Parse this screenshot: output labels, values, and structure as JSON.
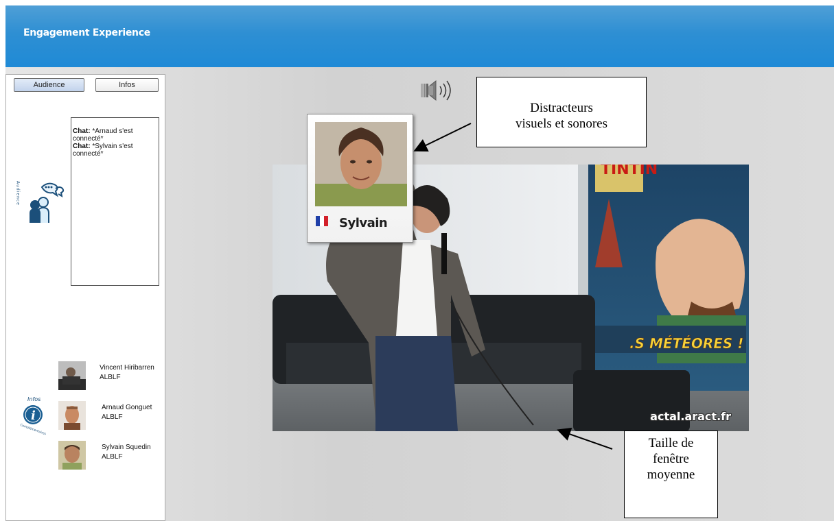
{
  "header": {
    "title": "Engagement Experience"
  },
  "sidebar": {
    "tabs": [
      {
        "label": "Audience"
      },
      {
        "label": "Infos"
      }
    ],
    "audience_label": "Audience",
    "infos_label": "Infos",
    "infos_sub_label": "Complémentaires",
    "chat": [
      {
        "prefix": "Chat:",
        "text": " *Arnaud s'est connecté*"
      },
      {
        "prefix": "Chat:",
        "text": " *Sylvain s'est connecté*"
      }
    ],
    "users": [
      {
        "name": "Vincent Hiribarren",
        "org": "ALBLF"
      },
      {
        "name": "Arnaud Gonguet",
        "org": "ALBLF"
      },
      {
        "name": "Sylvain Squedin",
        "org": "ALBLF"
      }
    ]
  },
  "video": {
    "watermark": "actal.aract.fr",
    "poster_text": ".S MÉTÉORES !",
    "poster_top": "TINTIN"
  },
  "profile_card": {
    "name": "Sylvain"
  },
  "callouts": {
    "distractors_line1": "Distracteurs",
    "distractors_line2": "visuels et sonores",
    "window_line1": "Taille de",
    "window_line2": "fenêtre",
    "window_line3": "moyenne"
  },
  "colors": {
    "header_blue": "#2e8fd3",
    "tab_active": "#c2d3ec"
  },
  "icons": [
    "audience-icon",
    "infos-icon",
    "speaker-icon",
    "french-flag-icon"
  ]
}
